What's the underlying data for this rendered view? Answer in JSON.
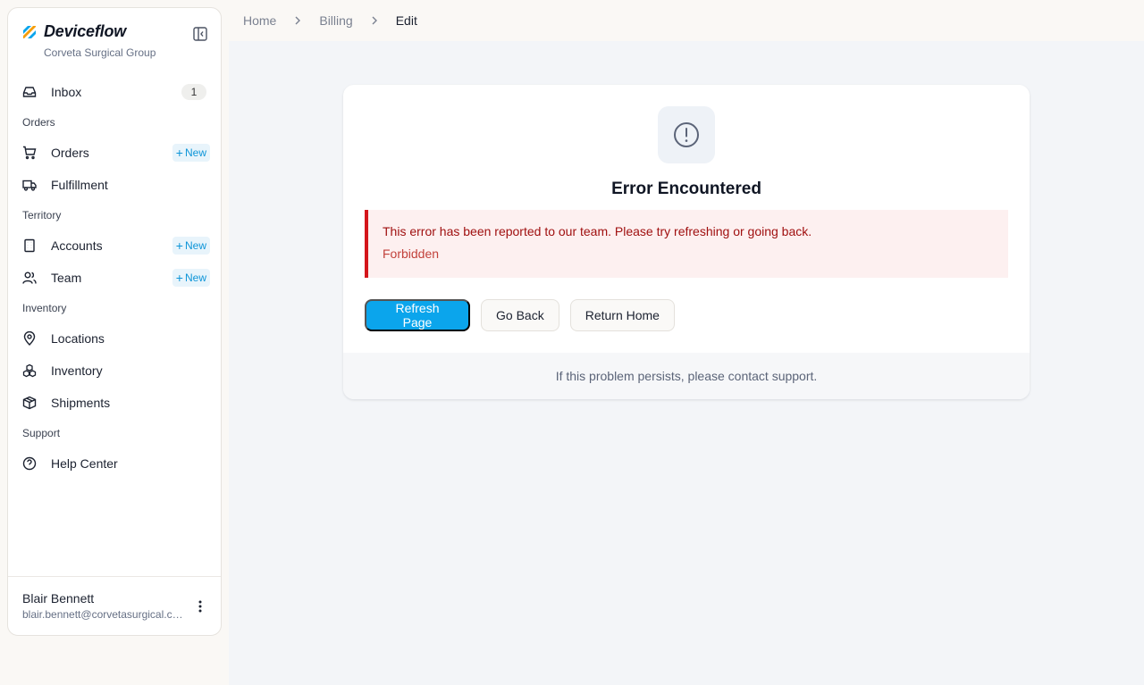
{
  "brand": {
    "name": "Deviceflow",
    "org": "Corveta Surgical Group"
  },
  "sidebar": {
    "inbox": {
      "label": "Inbox",
      "count": "1"
    },
    "sections": {
      "orders": "Orders",
      "territory": "Territory",
      "inventory": "Inventory",
      "support": "Support"
    },
    "items": {
      "orders": "Orders",
      "fulfillment": "Fulfillment",
      "accounts": "Accounts",
      "team": "Team",
      "locations": "Locations",
      "inventory": "Inventory",
      "shipments": "Shipments",
      "help": "Help Center"
    },
    "new_label": "New"
  },
  "user": {
    "name": "Blair Bennett",
    "email": "blair.bennett@corvetasurgical.com"
  },
  "breadcrumb": {
    "home": "Home",
    "billing": "Billing",
    "current": "Edit"
  },
  "error": {
    "title": "Error Encountered",
    "message": "This error has been reported to our team. Please try refreshing or going back.",
    "detail": "Forbidden",
    "refresh": "Refresh Page",
    "back": "Go Back",
    "home": "Return Home",
    "footer": "If this problem persists, please contact support."
  },
  "colors": {
    "accent": "#0ba5ec",
    "error": "#d4151b",
    "error_bg": "#fdf0f0"
  }
}
